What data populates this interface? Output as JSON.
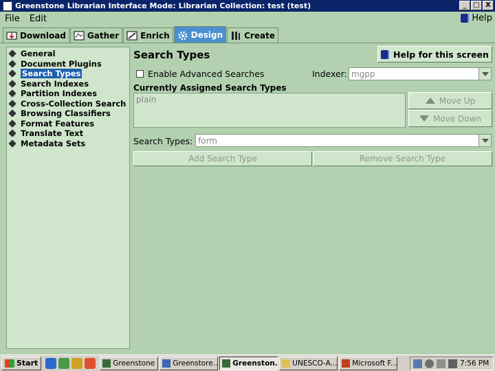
{
  "window": {
    "title": "Greenstone Librarian Interface Mode: Librarian Collection: test (test)",
    "controls": [
      "_",
      "□",
      "X"
    ]
  },
  "menubar": {
    "file": "File",
    "edit": "Edit",
    "help": "Help"
  },
  "tabs": [
    {
      "label": "Download",
      "icon": "download-icon"
    },
    {
      "label": "Gather",
      "icon": "gather-icon"
    },
    {
      "label": "Enrich",
      "icon": "enrich-icon"
    },
    {
      "label": "Design",
      "icon": "design-icon",
      "active": true
    },
    {
      "label": "Create",
      "icon": "create-icon"
    }
  ],
  "sidebar": {
    "items": [
      {
        "label": "General"
      },
      {
        "label": "Document Plugins"
      },
      {
        "label": "Search Types",
        "selected": true
      },
      {
        "label": "Search Indexes"
      },
      {
        "label": "Partition Indexes"
      },
      {
        "label": "Cross-Collection Search"
      },
      {
        "label": "Browsing Classifiers"
      },
      {
        "label": "Format Features"
      },
      {
        "label": "Translate Text"
      },
      {
        "label": "Metadata Sets"
      }
    ]
  },
  "main": {
    "title": "Search Types",
    "help_button": "Help for this screen",
    "enable_advanced_label": "Enable Advanced Searches",
    "enable_advanced_checked": false,
    "indexer_label": "Indexer:",
    "indexer_value": "mgpp",
    "assigned_label": "Currently Assigned Search Types",
    "assigned_items": [
      "plain"
    ],
    "move_up": "Move Up",
    "move_down": "Move Down",
    "search_types_label": "Search Types:",
    "search_types_value": "form",
    "add_button": "Add Search Type",
    "remove_button": "Remove Search Type"
  },
  "taskbar": {
    "start": "Start",
    "tasks": [
      {
        "label": "Greenstone ..",
        "icon": "network-icon"
      },
      {
        "label": "Greenstore...",
        "icon": "window-icon"
      },
      {
        "label": "Greenston...",
        "icon": "network-icon",
        "active": true
      },
      {
        "label": "UNESCO-A...",
        "icon": "folder-icon"
      },
      {
        "label": "Microsoft F...",
        "icon": "powerpoint-icon"
      }
    ],
    "clock": "7:56 PM"
  },
  "colors": {
    "background": "#b3d1b0",
    "panel": "#cfe6cc",
    "active_tab": "#4a8fcf",
    "selection": "#1f5fb0",
    "titlebar": "#0a246a"
  }
}
